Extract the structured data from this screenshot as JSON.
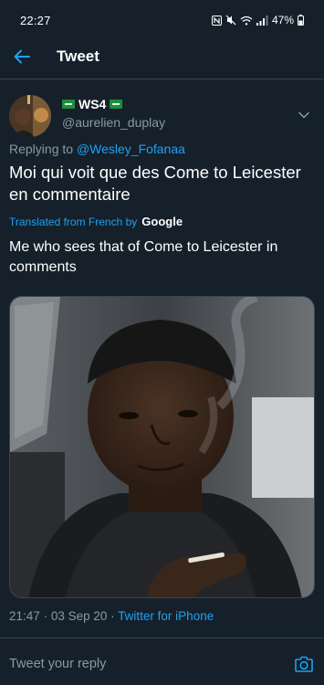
{
  "status_bar": {
    "time": "22:27",
    "battery": "47%",
    "icons": [
      "nfc-icon",
      "mute-icon",
      "wifi-icon",
      "signal-icon",
      "battery-icon"
    ]
  },
  "header": {
    "title": "Tweet",
    "back_icon": "arrow-left-icon"
  },
  "tweet": {
    "display_name": "WS4",
    "handle": "@aurelien_duplay",
    "replying_prefix": "Replying to",
    "replying_to": "@Wesley_Fofanaa",
    "text": "Moi qui voit que des Come to Leicester en commentaire",
    "translated_label": "Translated from French by",
    "translated_provider": "Google",
    "translation": "Me who sees that of Come to Leicester in comments",
    "time": "21:47",
    "date": "03 Sep 20",
    "source": "Twitter for iPhone"
  },
  "reply": {
    "placeholder": "Tweet your reply"
  },
  "colors": {
    "background": "#15202b",
    "accent": "#1da1f2",
    "muted": "#8899a6",
    "divider": "#38444d"
  }
}
